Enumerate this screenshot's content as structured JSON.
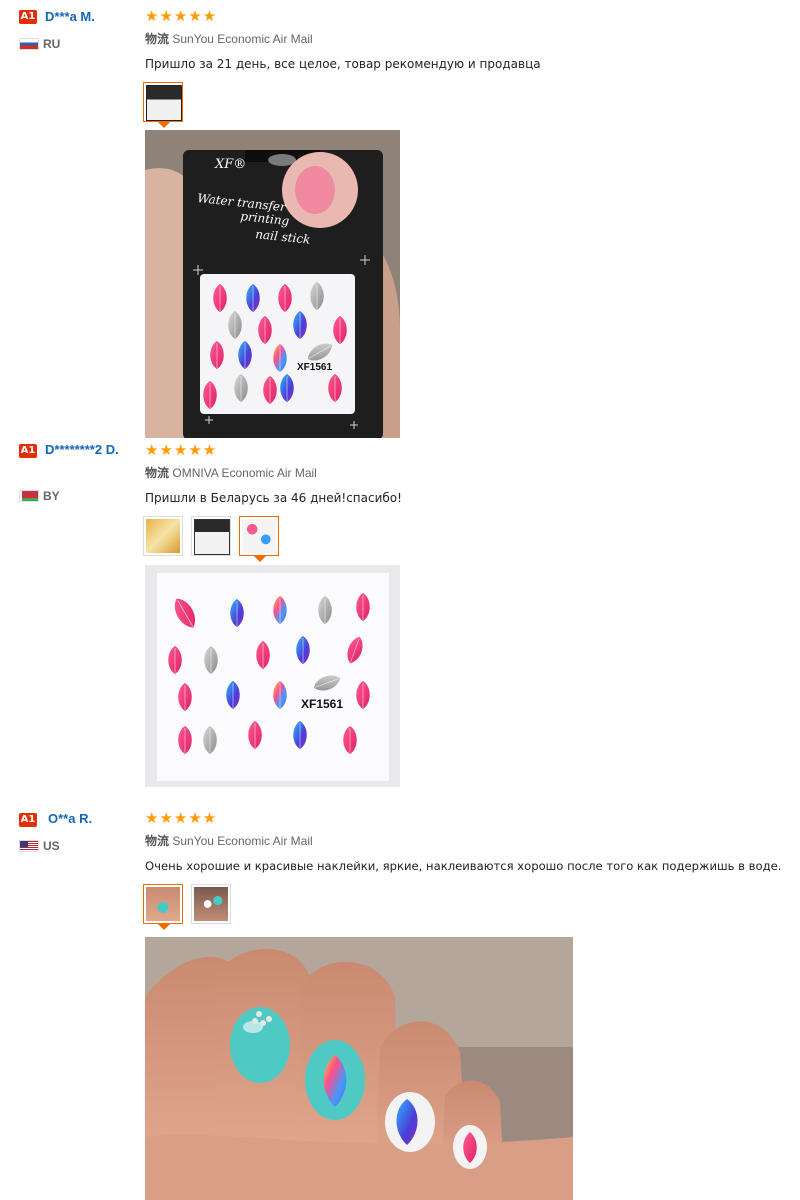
{
  "reviews": [
    {
      "badge": "A1",
      "name": "D***a M.",
      "country": "RU",
      "stars": "★★★★★",
      "shipping_cn": "物流",
      "shipping": "SunYou Economic Air Mail",
      "comment": "Пришло за 21 день, все целое, товар рекомендую и продавца",
      "photo_texts": {
        "brand": "XF®",
        "line1": "Water transfer",
        "line2": "printing",
        "line3": "nail stick",
        "code": "XF1561"
      }
    },
    {
      "badge": "A1",
      "name": "D********2 D.",
      "country": "BY",
      "stars": "★★★★★",
      "shipping_cn": "物流",
      "shipping": "OMNIVA Economic Air Mail",
      "comment": "Пришли в Беларусь за 46 дней!спасибо!",
      "photo_texts": {
        "code": "XF1561"
      }
    },
    {
      "badge": "A1",
      "name": "O**a R.",
      "country": "US",
      "stars": "★★★★★",
      "shipping_cn": "物流",
      "shipping": "SunYou Economic Air Mail",
      "comment": "Очень хорошие и красивые наклейки, яркие, наклеиваются хорошо после того как подержишь в воде."
    }
  ],
  "colors": {
    "accent": "#f26b00",
    "link": "#1466b8",
    "star": "#ff9a00",
    "badge": "#e62e04"
  },
  "icons": [
    "flag-ru-icon",
    "flag-by-icon",
    "flag-us-icon",
    "star-icon"
  ]
}
